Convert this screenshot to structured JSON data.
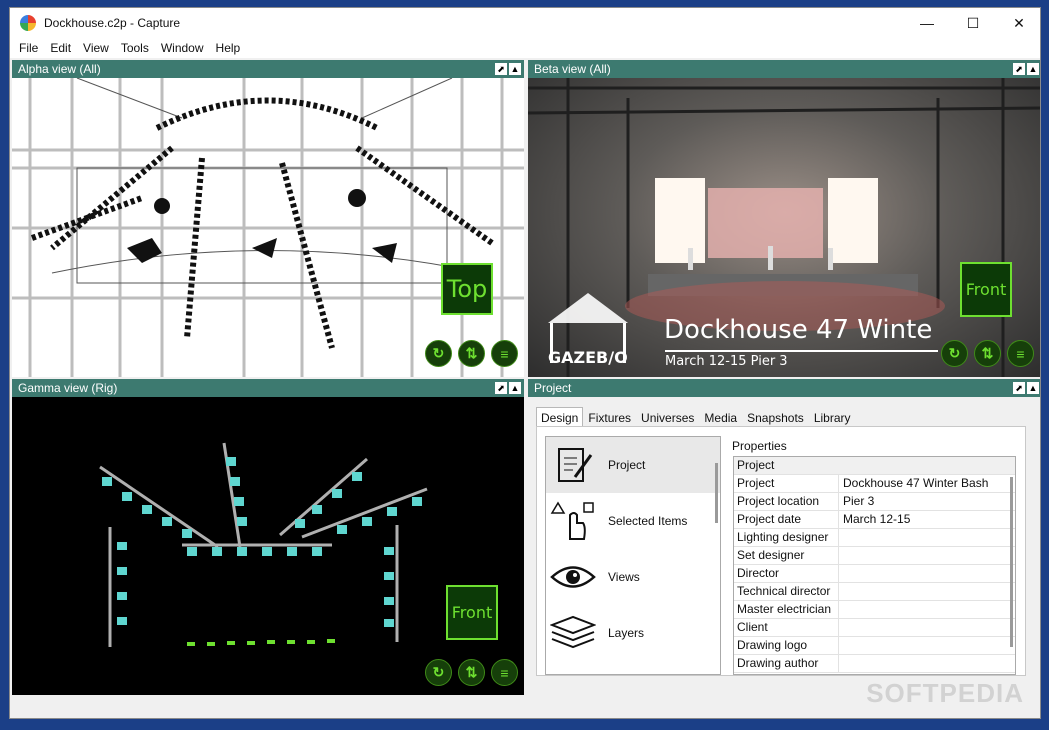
{
  "window": {
    "title": "Dockhouse.c2p - Capture",
    "minimize": "—",
    "maximize": "☐",
    "close": "✕"
  },
  "menu": [
    "File",
    "Edit",
    "View",
    "Tools",
    "Window",
    "Help"
  ],
  "alpha": {
    "title": "Alpha view  (All)",
    "tag": "Top"
  },
  "beta": {
    "title": "Beta view  (All)",
    "tag": "Front",
    "banner_title": "Dockhouse 47 Winte",
    "banner_sub": "March 12-15 Pier 3",
    "logo": "GAZEB/O"
  },
  "gamma": {
    "title": "Gamma view  (Rig)",
    "tag": "Front"
  },
  "project": {
    "title": "Project",
    "tabs": [
      "Design",
      "Fixtures",
      "Universes",
      "Media",
      "Snapshots",
      "Library"
    ],
    "categories": [
      "Project",
      "Selected Items",
      "Views",
      "Layers"
    ],
    "properties_title": "Properties",
    "section": "Project",
    "rows": [
      {
        "k": "Project",
        "v": "Dockhouse 47 Winter Bash"
      },
      {
        "k": "Project location",
        "v": "Pier 3"
      },
      {
        "k": "Project date",
        "v": "March 12-15"
      },
      {
        "k": "Lighting designer",
        "v": ""
      },
      {
        "k": "Set designer",
        "v": ""
      },
      {
        "k": "Director",
        "v": ""
      },
      {
        "k": "Technical director",
        "v": ""
      },
      {
        "k": "Master electrician",
        "v": ""
      },
      {
        "k": "Client",
        "v": ""
      },
      {
        "k": "Drawing logo",
        "v": ""
      },
      {
        "k": "Drawing author",
        "v": ""
      }
    ]
  },
  "watermark": "SOFTPEDIA",
  "colors": {
    "pane_header": "#3d7a70",
    "accent_green": "#6ee030",
    "fixture_cyan": "#5fd6d0"
  }
}
